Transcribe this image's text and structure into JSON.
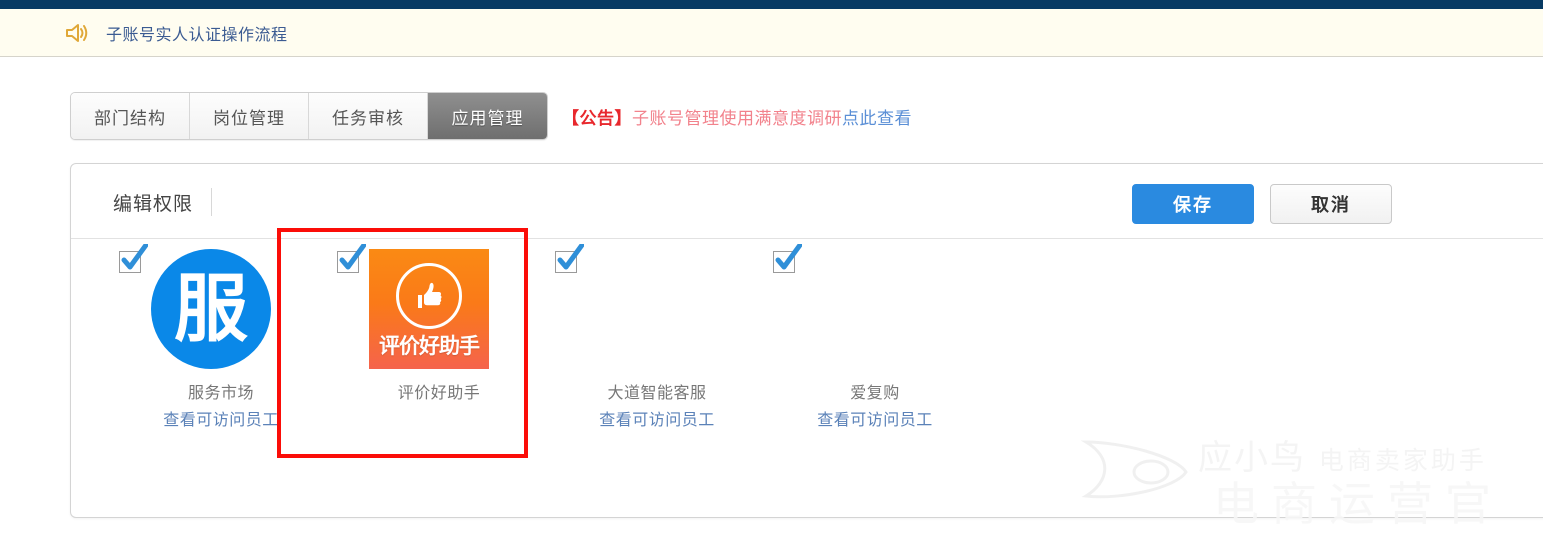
{
  "notice": {
    "icon": "speaker-icon",
    "text": "子账号实人认证操作流程"
  },
  "tabs": [
    {
      "label": "部门结构",
      "active": false
    },
    {
      "label": "岗位管理",
      "active": false
    },
    {
      "label": "任务审核",
      "active": false
    },
    {
      "label": "应用管理",
      "active": true
    }
  ],
  "announcement": {
    "tag": "【公告】",
    "body": "子账号管理使用满意度调研",
    "link": "点此查看"
  },
  "panel": {
    "title": "编辑权限",
    "save_label": "保存",
    "cancel_label": "取消"
  },
  "apps": [
    {
      "name": "服务市场",
      "link": "查看可访问员工",
      "checked": true,
      "icon_type": "circle-logo",
      "icon_glyph": "服",
      "icon_color": "#0a88e8",
      "has_link": true
    },
    {
      "name": "评价好助手",
      "link": "",
      "checked": true,
      "icon_type": "square-logo",
      "icon_glyph": "👍",
      "icon_text": "评价好助手",
      "icon_color": "#fa7a18",
      "has_link": false
    },
    {
      "name": "大道智能客服",
      "link": "查看可访问员工",
      "checked": true,
      "icon_type": "none",
      "icon_glyph": "",
      "has_link": true
    },
    {
      "name": "爱复购",
      "link": "查看可访问员工",
      "checked": true,
      "icon_type": "none",
      "icon_glyph": "",
      "has_link": true
    }
  ],
  "highlight": {
    "target": "评价好助手",
    "color": "#fb0d08"
  },
  "watermark": {
    "brand": "应小鸟",
    "tagline": "电商卖家助手",
    "sub": "电商运营官"
  },
  "colors": {
    "topbar": "#083a63",
    "notice_bg": "#fffdf0",
    "notice_text": "#3b5b92",
    "accent_blue": "#2a8ae0",
    "link_blue": "#5b82b8",
    "announce_red": "#e8282d",
    "announce_pink": "#f2828c",
    "tab_active_bg": "#7a7a7a",
    "highlight_red": "#fb0d08"
  }
}
